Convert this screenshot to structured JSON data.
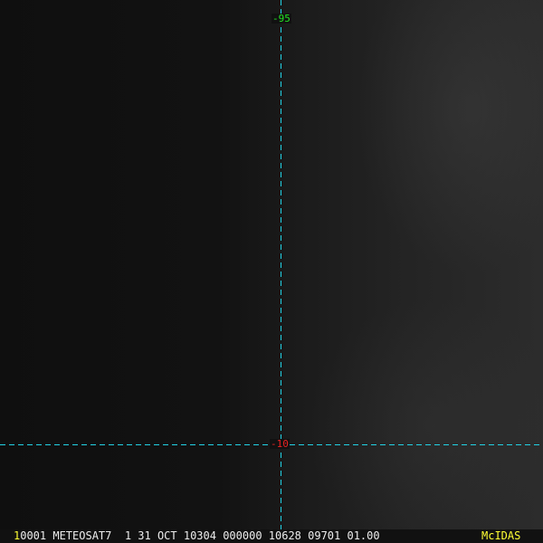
{
  "image": {
    "longitude_label": "-95",
    "latitude_label": "-10",
    "colors": {
      "grid": "#22d3e6",
      "lon_label": "#22e622",
      "lat_label": "#e62222",
      "brand": "#ffff33"
    }
  },
  "status_bar": {
    "frame_number": "1",
    "info": "0001 METEOSAT7  1 31 OCT 10304 000000 10628 09701 01.00",
    "brand": "McIDAS"
  }
}
